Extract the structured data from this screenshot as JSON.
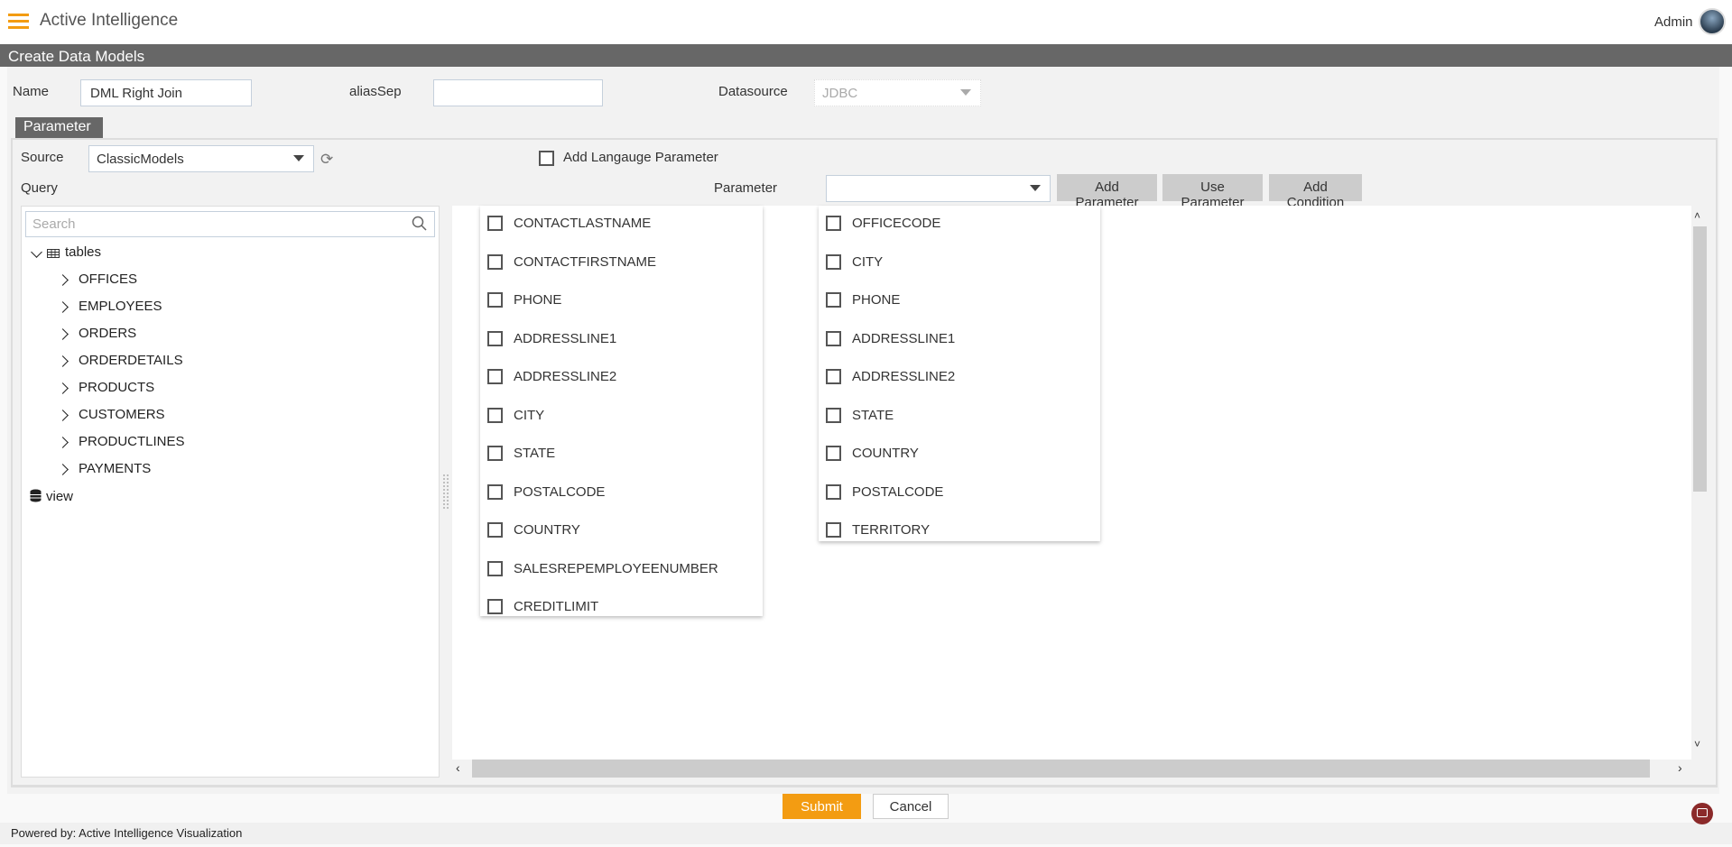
{
  "app": {
    "title": "Active Intelligence",
    "user": "Admin"
  },
  "page": {
    "title": "Create Data Models"
  },
  "form": {
    "name_label": "Name",
    "name_value": "DML Right Join",
    "aliassep_label": "aliasSep",
    "aliassep_value": "",
    "datasource_label": "Datasource",
    "datasource_value": "JDBC"
  },
  "tab": {
    "label": "Parameter"
  },
  "query": {
    "source_label": "Source",
    "source_value": "ClassicModels",
    "lang_param_label": "Add Langauge Parameter",
    "lang_param_checked": false,
    "query_label": "Query",
    "parameter_label": "Parameter",
    "parameter_value": "",
    "buttons": {
      "add_parameter": "Add Parameter",
      "use_parameter": "Use Parameter",
      "add_condition": "Add Condition"
    }
  },
  "tree": {
    "search_placeholder": "Search",
    "tables_label": "tables",
    "tables": [
      "OFFICES",
      "EMPLOYEES",
      "ORDERS",
      "ORDERDETAILS",
      "PRODUCTS",
      "CUSTOMERS",
      "PRODUCTLINES",
      "PAYMENTS"
    ],
    "view_label": "view"
  },
  "columns_left": [
    "CONTACTLASTNAME",
    "CONTACTFIRSTNAME",
    "PHONE",
    "ADDRESSLINE1",
    "ADDRESSLINE2",
    "CITY",
    "STATE",
    "POSTALCODE",
    "COUNTRY",
    "SALESREPEMPLOYEENUMBER",
    "CREDITLIMIT"
  ],
  "columns_right": [
    "OFFICECODE",
    "CITY",
    "PHONE",
    "ADDRESSLINE1",
    "ADDRESSLINE2",
    "STATE",
    "COUNTRY",
    "POSTALCODE",
    "TERRITORY"
  ],
  "actions": {
    "submit": "Submit",
    "cancel": "Cancel"
  },
  "footer": {
    "text": "Powered by: Active Intelligence Visualization"
  },
  "colors": {
    "accent": "#f39c12",
    "header_bar": "#676767"
  }
}
